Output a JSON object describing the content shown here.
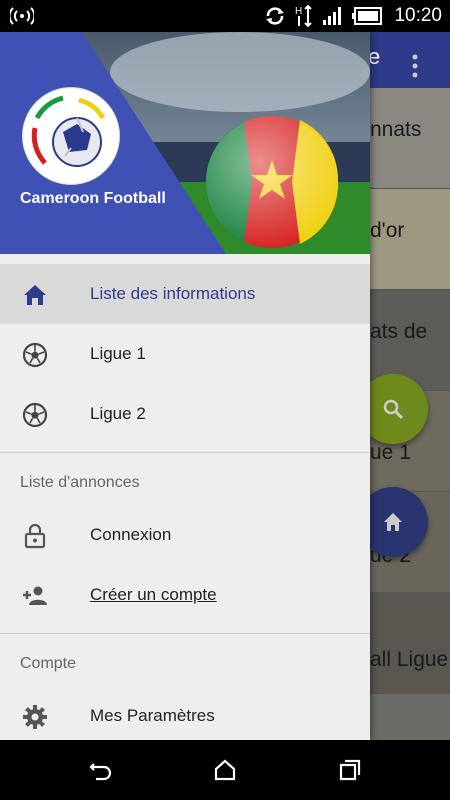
{
  "status_bar": {
    "time": "10:20",
    "icons": [
      "wifi-hotspot-icon",
      "sync-icon",
      "data-transfer-icon",
      "signal-icon",
      "battery-icon"
    ]
  },
  "background_app": {
    "title_fragment": "e",
    "rows": [
      "nnats",
      "d'or",
      "ats de",
      "ue 1",
      "ue 2",
      "all Ligue"
    ],
    "fab_search_color": "#7a9a1a",
    "fab_home_color": "#2e3a8a"
  },
  "drawer": {
    "header_title": "Cameroon Football",
    "header_color": "#3f51b5",
    "items": [
      {
        "label": "Liste des informations",
        "icon": "home-icon",
        "active": true
      },
      {
        "label": "Ligue 1",
        "icon": "soccer-ball-icon"
      },
      {
        "label": "Ligue 2",
        "icon": "soccer-ball-icon"
      }
    ],
    "section_announcements": "Liste d'annonces",
    "announce_items": [
      {
        "label": "Connexion",
        "icon": "lock-icon"
      },
      {
        "label": "Créer un compte",
        "icon": "add-user-icon"
      }
    ],
    "section_account": "Compte",
    "account_items": [
      {
        "label": "Mes Paramètres",
        "icon": "gear-icon"
      }
    ]
  },
  "nav_bar": {
    "icons": [
      "back-icon",
      "home-icon",
      "recents-icon"
    ]
  }
}
